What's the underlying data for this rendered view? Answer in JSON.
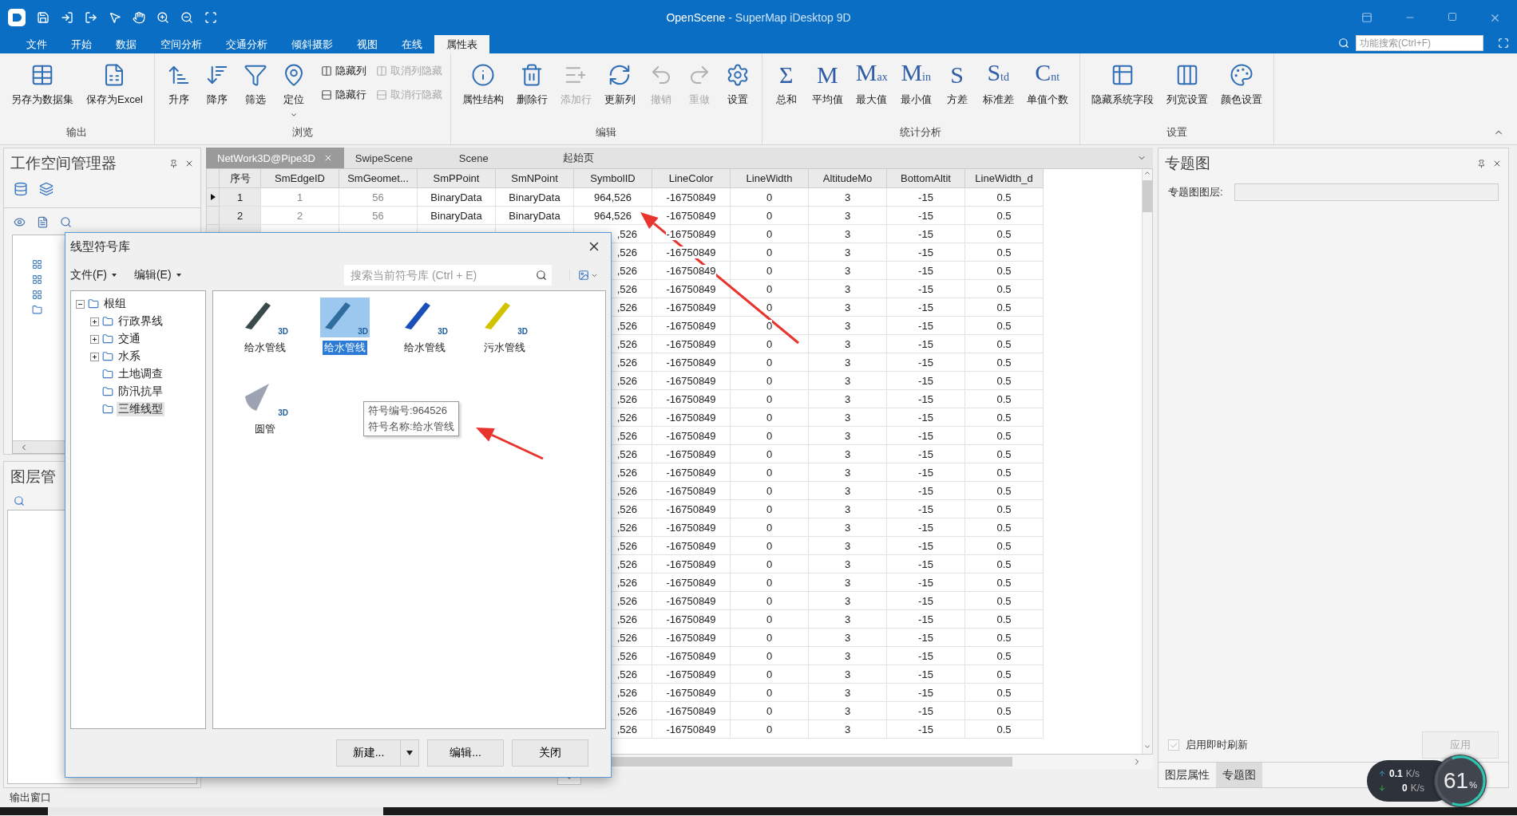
{
  "window": {
    "document": "OpenScene",
    "app_name": " - SuperMap iDesktop 9D"
  },
  "search": {
    "placeholder": "功能搜索(Ctrl+F)"
  },
  "menu_tabs": [
    {
      "label": "文件",
      "selected": false
    },
    {
      "label": "开始",
      "selected": false
    },
    {
      "label": "数据",
      "selected": false
    },
    {
      "label": "空间分析",
      "selected": false
    },
    {
      "label": "交通分析",
      "selected": false
    },
    {
      "label": "倾斜摄影",
      "selected": false
    },
    {
      "label": "视图",
      "selected": false
    },
    {
      "label": "在线",
      "selected": false
    },
    {
      "label": "属性表",
      "selected": true
    }
  ],
  "ribbon": {
    "groups": [
      {
        "label": "输出",
        "buttons": [
          {
            "kind": "large",
            "label": "另存为数据集",
            "disabled": false
          },
          {
            "kind": "large",
            "label": "保存为Excel",
            "disabled": false
          }
        ]
      },
      {
        "label": "浏览",
        "buttons": [
          {
            "kind": "large",
            "label": "升序",
            "disabled": false
          },
          {
            "kind": "large",
            "label": "降序",
            "disabled": false
          },
          {
            "kind": "large",
            "label": "筛选",
            "disabled": false
          },
          {
            "kind": "dropdown",
            "label": "定位",
            "disabled": false
          }
        ],
        "small_buttons": [
          {
            "label": "隐藏列",
            "disabled": false
          },
          {
            "label": "隐藏行",
            "disabled": false
          },
          {
            "label": "取消列隐藏",
            "disabled": true
          },
          {
            "label": "取消行隐藏",
            "disabled": true
          }
        ]
      },
      {
        "label": "编辑",
        "buttons": [
          {
            "kind": "large",
            "label": "属性结构",
            "disabled": false
          },
          {
            "kind": "large",
            "label": "删除行",
            "disabled": false
          },
          {
            "kind": "large",
            "label": "添加行",
            "disabled": true
          },
          {
            "kind": "large",
            "label": "更新列",
            "disabled": false
          },
          {
            "kind": "large",
            "label": "撤销",
            "disabled": true
          },
          {
            "kind": "large",
            "label": "重做",
            "disabled": true
          },
          {
            "kind": "large",
            "label": "设置",
            "disabled": false
          }
        ]
      },
      {
        "label": "统计分析",
        "buttons": [
          {
            "kind": "glyph",
            "glyph": "Σ",
            "label": "总和",
            "disabled": false
          },
          {
            "kind": "glyph",
            "glyph": "M",
            "label": "平均值",
            "disabled": false
          },
          {
            "kind": "glyph",
            "glyph": "M$_{ax}$",
            "label": "最大值",
            "disabled": false
          },
          {
            "kind": "glyph",
            "glyph": "M$_{in}$",
            "label": "最小值",
            "disabled": false
          },
          {
            "kind": "glyph",
            "glyph": "S",
            "label": "方差",
            "disabled": false
          },
          {
            "kind": "glyph",
            "glyph": "S$_{td}$",
            "label": "标准差",
            "disabled": false
          },
          {
            "kind": "glyph",
            "glyph": "C$_{nt}$",
            "label": "单值个数",
            "disabled": false
          }
        ]
      },
      {
        "label": "设置",
        "buttons": [
          {
            "kind": "large",
            "label": "隐藏系统字段",
            "disabled": false
          },
          {
            "kind": "large",
            "label": "列宽设置",
            "disabled": false
          },
          {
            "kind": "large",
            "label": "颜色设置",
            "disabled": false
          }
        ]
      }
    ]
  },
  "workspace": {
    "title": "工作空间管理器"
  },
  "layers": {
    "title": "图层管"
  },
  "doc_tabs": [
    {
      "label": "NetWork3D@Pipe3D",
      "selected": true
    },
    {
      "label": "SwipeScene",
      "selected": false
    },
    {
      "label": "Scene",
      "selected": false
    },
    {
      "label": "起始页",
      "selected": false
    }
  ],
  "table": {
    "columns": [
      "序号",
      "SmEdgeID",
      "SmGeomet...",
      "SmPPoint",
      "SmNPoint",
      "SymbolID",
      "LineColor",
      "LineWidth",
      "AltitudeMo",
      "BottomAltit",
      "LineWidth_d"
    ],
    "rows": [
      {
        "current": true,
        "cells": [
          "1",
          "1",
          "56",
          "BinaryData",
          "BinaryData",
          "964,526",
          "-16750849",
          "0",
          "3",
          "-15",
          "0.5"
        ]
      },
      {
        "current": false,
        "cells": [
          "2",
          "2",
          "56",
          "BinaryData",
          "BinaryData",
          "964,526",
          "-16750849",
          "0",
          "3",
          "-15",
          "0.5"
        ]
      }
    ],
    "covered_rows": [
      {
        "cells": [
          ",526",
          "-16750849",
          "0",
          "3",
          "-15",
          "0.5"
        ]
      },
      {
        "cells": [
          ",526",
          "-16750849",
          "0",
          "3",
          "-15",
          "0.5"
        ]
      },
      {
        "cells": [
          ",526",
          "-16750849",
          "0",
          "3",
          "-15",
          "0.5"
        ]
      },
      {
        "cells": [
          ",526",
          "-16750849",
          "0",
          "3",
          "-15",
          "0.5"
        ]
      },
      {
        "cells": [
          ",526",
          "-16750849",
          "0",
          "3",
          "-15",
          "0.5"
        ]
      },
      {
        "cells": [
          ",526",
          "-16750849",
          "0",
          "3",
          "-15",
          "0.5"
        ]
      },
      {
        "cells": [
          ",526",
          "-16750849",
          "0",
          "3",
          "-15",
          "0.5"
        ]
      },
      {
        "cells": [
          ",526",
          "-16750849",
          "0",
          "3",
          "-15",
          "0.5"
        ]
      },
      {
        "cells": [
          ",526",
          "-16750849",
          "0",
          "3",
          "-15",
          "0.5"
        ]
      },
      {
        "cells": [
          ",526",
          "-16750849",
          "0",
          "3",
          "-15",
          "0.5"
        ]
      },
      {
        "cells": [
          ",526",
          "-16750849",
          "0",
          "3",
          "-15",
          "0.5"
        ]
      },
      {
        "cells": [
          ",526",
          "-16750849",
          "0",
          "3",
          "-15",
          "0.5"
        ]
      },
      {
        "cells": [
          ",526",
          "-16750849",
          "0",
          "3",
          "-15",
          "0.5"
        ]
      },
      {
        "cells": [
          ",526",
          "-16750849",
          "0",
          "3",
          "-15",
          "0.5"
        ]
      },
      {
        "cells": [
          ",526",
          "-16750849",
          "0",
          "3",
          "-15",
          "0.5"
        ]
      },
      {
        "cells": [
          ",526",
          "-16750849",
          "0",
          "3",
          "-15",
          "0.5"
        ]
      },
      {
        "cells": [
          ",526",
          "-16750849",
          "0",
          "3",
          "-15",
          "0.5"
        ]
      },
      {
        "cells": [
          ",526",
          "-16750849",
          "0",
          "3",
          "-15",
          "0.5"
        ]
      },
      {
        "cells": [
          ",526",
          "-16750849",
          "0",
          "3",
          "-15",
          "0.5"
        ]
      },
      {
        "cells": [
          ",526",
          "-16750849",
          "0",
          "3",
          "-15",
          "0.5"
        ]
      },
      {
        "cells": [
          ",526",
          "-16750849",
          "0",
          "3",
          "-15",
          "0.5"
        ]
      },
      {
        "cells": [
          ",526",
          "-16750849",
          "0",
          "3",
          "-15",
          "0.5"
        ]
      },
      {
        "cells": [
          ",526",
          "-16750849",
          "0",
          "3",
          "-15",
          "0.5"
        ]
      },
      {
        "cells": [
          ",526",
          "-16750849",
          "0",
          "3",
          "-15",
          "0.5"
        ]
      },
      {
        "cells": [
          ",526",
          "-16750849",
          "0",
          "3",
          "-15",
          "0.5"
        ]
      },
      {
        "cells": [
          ",526",
          "-16750849",
          "0",
          "3",
          "-15",
          "0.5"
        ]
      },
      {
        "cells": [
          ",526",
          "-16750849",
          "0",
          "3",
          "-15",
          "0.5"
        ]
      },
      {
        "cells": [
          ",526",
          "-16750849",
          "0",
          "3",
          "-15",
          "0.5"
        ]
      }
    ]
  },
  "theme_panel": {
    "title": "专题图",
    "layer_label": "专题图图层:",
    "realtime": {
      "label": "启用即时刷新",
      "checked": true
    },
    "apply": "应用",
    "tabs": [
      {
        "label": "图层属性",
        "selected": false
      },
      {
        "label": "专题图",
        "selected": true
      }
    ]
  },
  "dialog": {
    "title": "线型符号库",
    "menus": [
      "文件(F)",
      "编辑(E)"
    ],
    "search_placeholder": "搜索当前符号库 (Ctrl + E)",
    "tree": {
      "label": "根组",
      "expanded": true,
      "children": [
        {
          "kind": "group",
          "label": "行政界线",
          "expanded": false,
          "selected": false
        },
        {
          "kind": "group",
          "label": "交通",
          "expanded": false,
          "selected": false
        },
        {
          "kind": "group",
          "label": "水系",
          "expanded": false,
          "selected": false
        },
        {
          "kind": "leaf",
          "label": "土地调查",
          "selected": false
        },
        {
          "kind": "leaf",
          "label": "防汛抗旱",
          "selected": false
        },
        {
          "kind": "leaf",
          "label": "三维线型",
          "selected": true
        }
      ]
    },
    "symbols": [
      {
        "kind": "pipe",
        "label": "给水管线",
        "badge": "3D",
        "color": "#3a4a4c",
        "selected": false
      },
      {
        "kind": "pipe",
        "label": "给水管线",
        "badge": "3D",
        "color": "#2f6e9c",
        "selected": true
      },
      {
        "kind": "pipe",
        "label": "给水管线",
        "badge": "3D",
        "color": "#1a4fb8",
        "selected": false
      },
      {
        "kind": "pipe",
        "label": "污水管线",
        "badge": "3D",
        "color": "#d2c300",
        "selected": false
      },
      {
        "kind": "cone",
        "label": "圆管",
        "badge": "3D",
        "color": "#9ea3b3",
        "selected": false
      }
    ],
    "tooltip": [
      "符号编号:964526",
      "符号名称:给水管线"
    ],
    "buttons": [
      {
        "kind": "split",
        "label": "新建..."
      },
      {
        "kind": "plain",
        "label": "编辑..."
      },
      {
        "kind": "plain",
        "label": "关闭"
      }
    ]
  },
  "status_bar": {
    "text": "输出窗口"
  },
  "net_widget": {
    "upload": {
      "value": "0.1",
      "unit": "K/s"
    },
    "download": {
      "value": "0",
      "unit": "K/s"
    },
    "cpu": {
      "value": "61",
      "unit": "%",
      "level": 0.61
    }
  }
}
